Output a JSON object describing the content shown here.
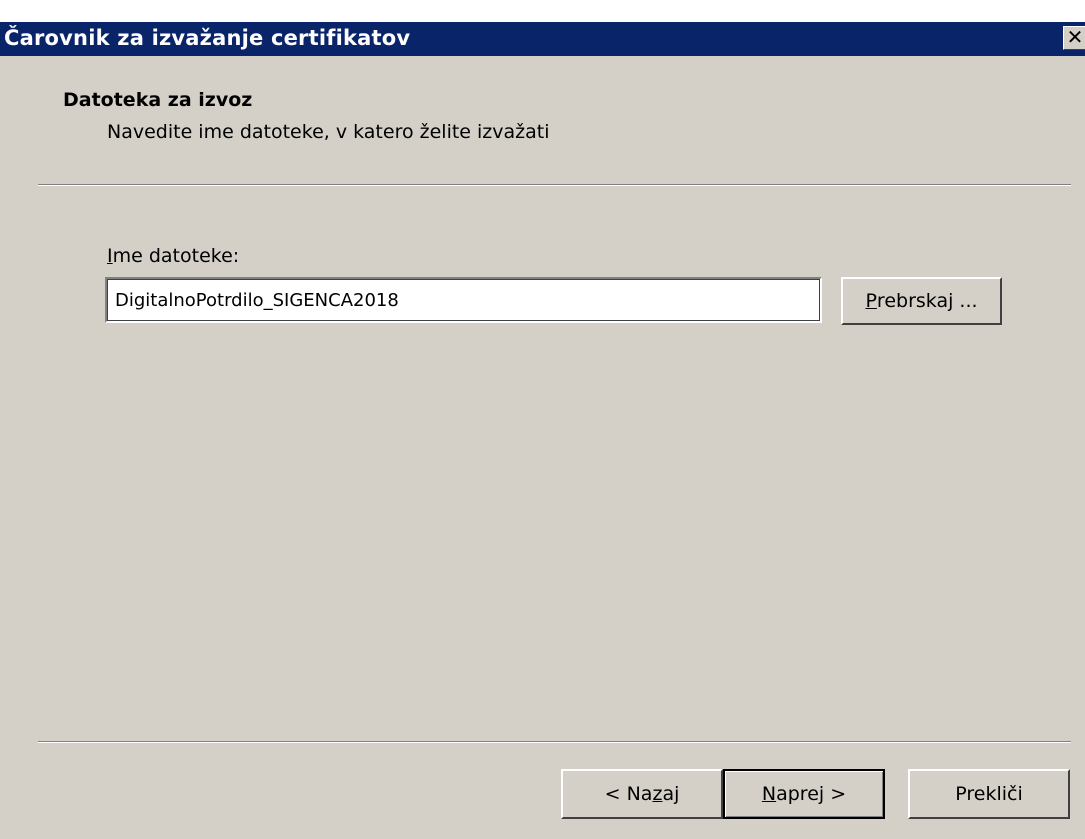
{
  "window": {
    "title": "Čarovnik za izvažanje certifikatov",
    "close_symbol": "✕"
  },
  "header": {
    "title": "Datoteka za izvoz",
    "subtitle": "Navedite ime datoteke, v katero želite izvažati"
  },
  "file_field": {
    "label_underlined": "I",
    "label_rest": "me datoteke:",
    "value": "DigitalnoPotrdilo_SIGENCA2018"
  },
  "buttons": {
    "browse_underlined": "P",
    "browse_rest": "rebrskaj ...",
    "back_prefix": "< Na",
    "back_underlined": "z",
    "back_suffix": "aj",
    "next_underlined": "N",
    "next_rest": "aprej >",
    "cancel": "Prekliči"
  },
  "icons": {
    "close": "close-icon"
  }
}
